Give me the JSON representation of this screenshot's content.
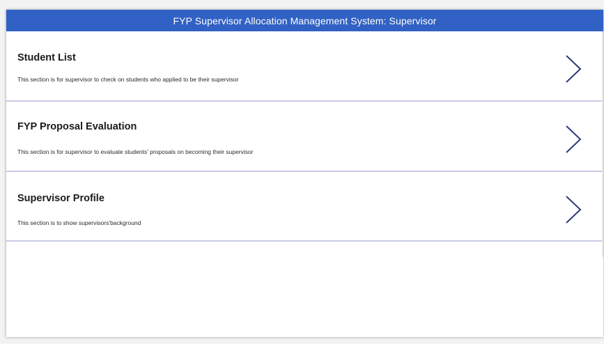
{
  "header": {
    "title": "FYP Supervisor Allocation Management System: Supervisor"
  },
  "items": [
    {
      "title": "Student List",
      "description": "This section is for supervisor to check on students who applied to be their supervisor",
      "icon": "chevron-right-icon"
    },
    {
      "title": "FYP Proposal Evaluation",
      "description": "This section is for supervisor to evaluate students' proposals on becoming their supervisor",
      "icon": "chevron-right-icon"
    },
    {
      "title": "Supervisor Profile",
      "description": "This section is to show supervisors'background",
      "icon": "chevron-right-icon"
    }
  ],
  "colors": {
    "header_bg": "#3161c4",
    "chevron": "#2b3a7a",
    "divider": "#c9cbe6"
  }
}
